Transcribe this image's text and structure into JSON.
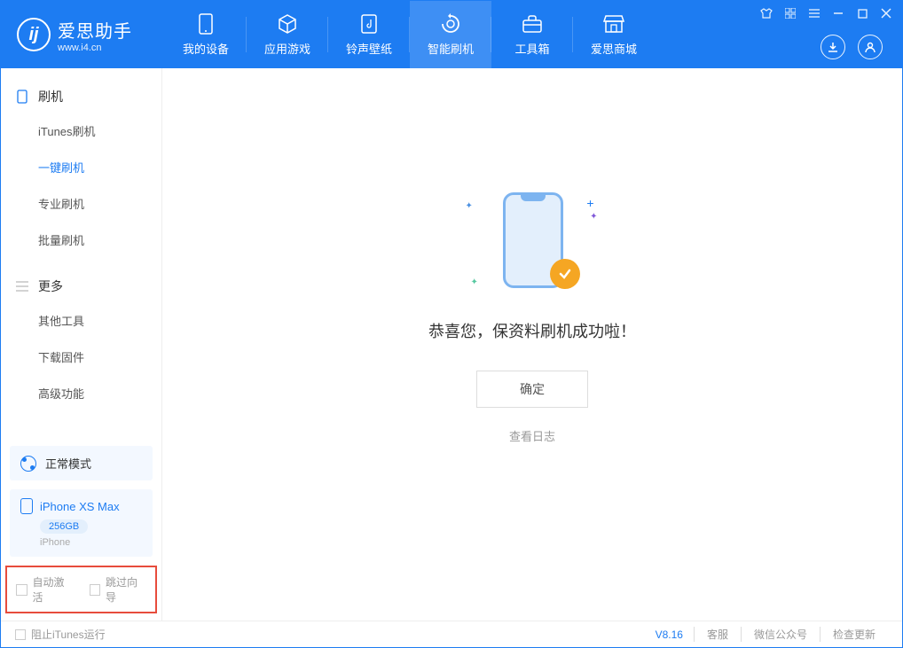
{
  "app": {
    "title": "爱思助手",
    "subtitle": "www.i4.cn"
  },
  "nav": {
    "tabs": [
      {
        "label": "我的设备",
        "icon": "device"
      },
      {
        "label": "应用游戏",
        "icon": "cube"
      },
      {
        "label": "铃声壁纸",
        "icon": "music"
      },
      {
        "label": "智能刷机",
        "icon": "refresh"
      },
      {
        "label": "工具箱",
        "icon": "toolbox"
      },
      {
        "label": "爱思商城",
        "icon": "store"
      }
    ],
    "active_index": 3
  },
  "sidebar": {
    "section1": {
      "title": "刷机",
      "items": [
        "iTunes刷机",
        "一键刷机",
        "专业刷机",
        "批量刷机"
      ],
      "active_index": 1
    },
    "section2": {
      "title": "更多",
      "items": [
        "其他工具",
        "下载固件",
        "高级功能"
      ]
    },
    "mode": {
      "label": "正常模式"
    },
    "device": {
      "name": "iPhone XS Max",
      "storage": "256GB",
      "type": "iPhone"
    },
    "options": {
      "auto_activate": "自动激活",
      "skip_guide": "跳过向导"
    }
  },
  "main": {
    "success_message": "恭喜您，保资料刷机成功啦！",
    "ok_button": "确定",
    "view_log": "查看日志"
  },
  "footer": {
    "block_itunes": "阻止iTunes运行",
    "version": "V8.16",
    "links": [
      "客服",
      "微信公众号",
      "检查更新"
    ]
  }
}
